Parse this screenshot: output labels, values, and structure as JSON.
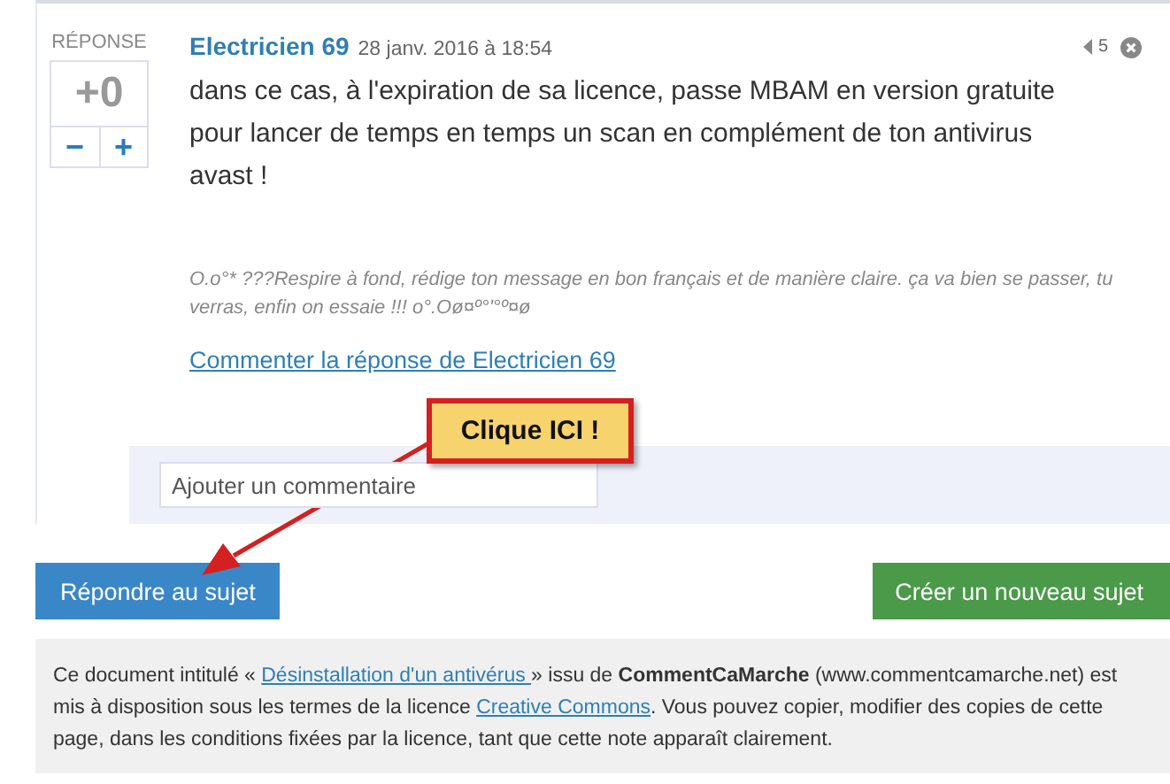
{
  "post": {
    "vote_label": "RÉPONSE",
    "score": "+0",
    "down": "−",
    "up": "+",
    "author": "Electricien 69",
    "date": "28 janv. 2016 à 18:54",
    "count": "5",
    "body": "dans ce cas, à l'expiration de sa licence, passe MBAM en version gratuite pour lancer de temps en temps un scan en complément de ton antivirus avast !",
    "signature": "O.o°* ???Respire à fond, rédige ton message en bon français et de manière claire. ça va bien se passer, tu verras, enfin on essaie !!! o°.Oø¤º°'°º¤ø",
    "comment_link": "Commenter la réponse de Electricien 69",
    "comment_field": {
      "placeholder": "Ajouter un commentaire"
    }
  },
  "callout": {
    "text": "Clique ICI !"
  },
  "buttons": [
    {
      "label": "Répondre au sujet",
      "kind": "primary"
    },
    {
      "label": "Créer un nouveau sujet",
      "kind": "success"
    }
  ],
  "footer": {
    "parts": [
      {
        "kind": "text",
        "text": "Ce document intitulé « "
      },
      {
        "kind": "link",
        "text": " Désinstallation d'un antivérus "
      },
      {
        "kind": "text",
        "text": " » issu de **CommentCaMarche** (www.commentcamarche.net) est mis à disposition sous les termes de la licence "
      },
      {
        "kind": "link",
        "text": "Creative Commons"
      },
      {
        "kind": "text",
        "text": ". Vous pouvez copier, modifier des copies de cette page, dans les conditions fixées par la licence, tant que cette note apparaît clairement."
      }
    ]
  }
}
